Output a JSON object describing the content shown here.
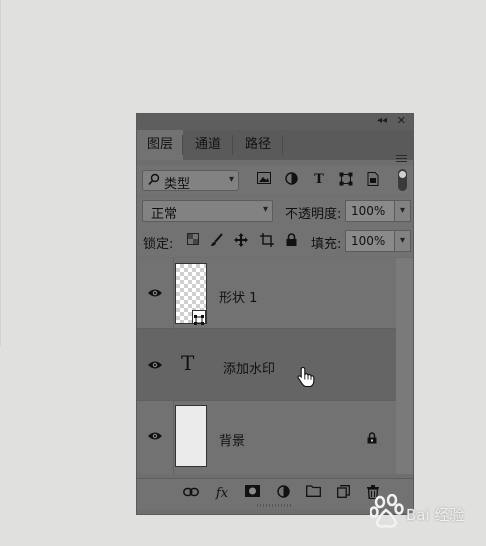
{
  "panel": {
    "tabs": [
      {
        "label": "图层",
        "active": true
      },
      {
        "label": "通道",
        "active": false
      },
      {
        "label": "路径",
        "active": false
      }
    ],
    "collapse_glyph": "◂◂",
    "close_glyph": "✕"
  },
  "filter": {
    "kind_value": "类型",
    "icons": [
      "image-filter-icon",
      "adjustment-filter-icon",
      "type-filter-icon",
      "shape-filter-icon",
      "smart-object-filter-icon"
    ]
  },
  "blend": {
    "mode_value": "正常",
    "opacity_label": "不透明度:",
    "opacity_value": "100%"
  },
  "lock": {
    "label": "锁定:",
    "fill_label": "填充:",
    "fill_value": "100%"
  },
  "layers": [
    {
      "name": "形状 1",
      "type": "shape",
      "visible": true,
      "selected": false
    },
    {
      "name": "添加水印",
      "type": "text",
      "visible": true,
      "selected": true,
      "type_glyph": "T"
    },
    {
      "name": "背景",
      "type": "background",
      "visible": true,
      "selected": false,
      "locked": true
    }
  ],
  "bottom_icons": [
    "link-layers-icon",
    "fx-icon",
    "layer-mask-icon",
    "adjustment-layer-icon",
    "new-group-icon",
    "new-layer-icon",
    "delete-layer-icon"
  ],
  "bottom_fx_label": "fx",
  "watermark": {
    "text": "Bai 经验"
  },
  "colors": {
    "panel_bg": "#727272",
    "selected_row": "#656565",
    "page_bg": "#e0e0de"
  }
}
